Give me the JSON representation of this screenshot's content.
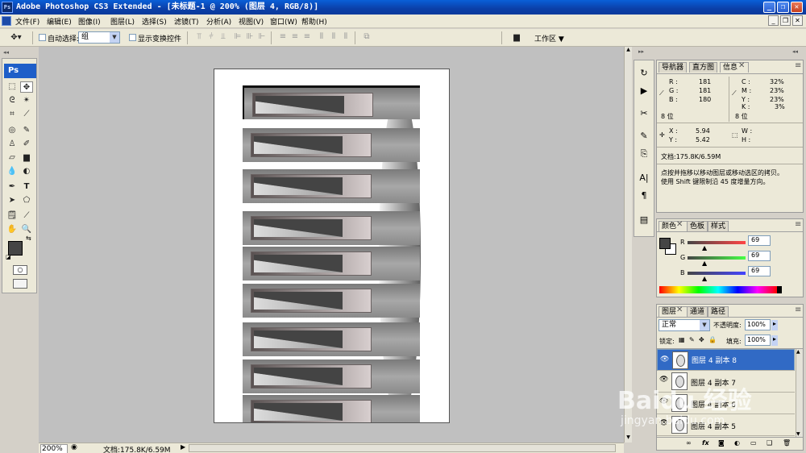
{
  "app": {
    "title": "Adobe Photoshop CS3 Extended - [未标题-1 @ 200% (图层 4, RGB/8)]",
    "logo": "Ps",
    "window_controls": [
      "_",
      "❐",
      "✕"
    ]
  },
  "menu": {
    "items": [
      "文件(F)",
      "编辑(E)",
      "图像(I)",
      "图层(L)",
      "选择(S)",
      "滤镜(T)",
      "分析(A)",
      "视图(V)",
      "窗口(W)",
      "帮助(H)"
    ]
  },
  "options": {
    "auto_select_label": "自动选择:",
    "auto_select_value": "组",
    "show_transform_label": "显示变换控件",
    "workspace_label": "工作区 ▼"
  },
  "toolbox": {
    "logo": "Ps"
  },
  "status": {
    "zoom": "200%",
    "doc_info": "文档:175.8K/6.59M"
  },
  "info_panel": {
    "tabs": [
      "导航器",
      "直方图",
      "信息"
    ],
    "r_label": "R :",
    "r_val": "181",
    "g_label": "G :",
    "g_val": "181",
    "b_label": "B :",
    "b_val": "180",
    "c_label": "C :",
    "c_val": "32%",
    "m_label": "M :",
    "m_val": "23%",
    "y_label": "Y :",
    "y_val": "23%",
    "k_label": "K :",
    "k_val": "3%",
    "bit_left": "8 位",
    "bit_right": "8 位",
    "x_label": "X :",
    "x_val": "5.94",
    "y2_label": "Y :",
    "y2_val": "5.42",
    "w_label": "W :",
    "h_label": "H :",
    "doc": "文档:175.8K/6.59M",
    "hint_line1": "点按并拖移以移动图层或移动选区的拷贝。",
    "hint_line2": "使用 Shift 键限制沿 45 度增量方向。"
  },
  "color_panel": {
    "tabs": [
      "颜色",
      "色板",
      "样式"
    ],
    "r_label": "R",
    "r_val": "69",
    "g_label": "G",
    "g_val": "69",
    "b_label": "B",
    "b_val": "69",
    "foreground": "#454545"
  },
  "layers_panel": {
    "tabs": [
      "图层",
      "通道",
      "路径"
    ],
    "blend_mode": "正常",
    "opacity_label": "不透明度:",
    "opacity_val": "100%",
    "lock_label": "锁定:",
    "fill_label": "填充:",
    "fill_val": "100%",
    "layers": [
      {
        "name": "图层 4 副本 8",
        "selected": true
      },
      {
        "name": "图层 4 副本 7",
        "selected": false
      },
      {
        "name": "图层 4 副本 6",
        "selected": false
      },
      {
        "name": "图层 4 副本 5",
        "selected": false
      }
    ]
  },
  "watermark": {
    "text": "Baidu 经验",
    "sub": "jingyan.baidu.com"
  },
  "colors": {
    "title_bar": "#0b3fa8",
    "selected_layer": "#316ac5",
    "accent": "#1e5ec8"
  }
}
